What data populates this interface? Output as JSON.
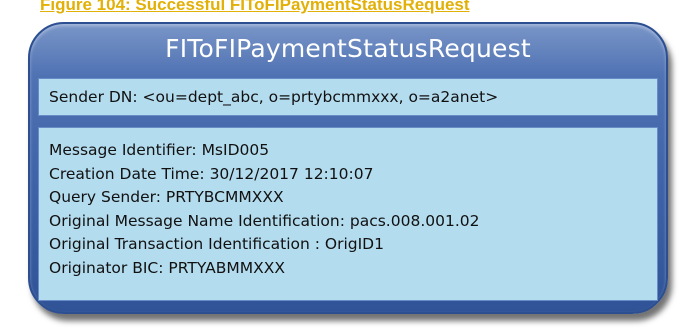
{
  "figure_caption": {
    "number": "Figure 104:",
    "text": " Successful FIToFIPaymentStatusRequest"
  },
  "diagram": {
    "title": "FIToFIPaymentStatusRequest",
    "sender_dn": "Sender DN: <ou=dept_abc, o=prtybcmmxxx, o=a2anet>",
    "details": [
      "Message Identifier: MsID005",
      "Creation Date Time: 30/12/2017  12:10:07",
      "Query Sender: PRTYBCMMXXX",
      "Original Message Name Identification: pacs.008.001.02",
      "Original Transaction Identification : OrigID1",
      "Originator BIC: PRTYABMMXXX"
    ]
  },
  "colors": {
    "caption": "#e2b006",
    "outer_box": "#3f63a8",
    "panel": "#b4dcef",
    "title_text": "#ffffff"
  }
}
